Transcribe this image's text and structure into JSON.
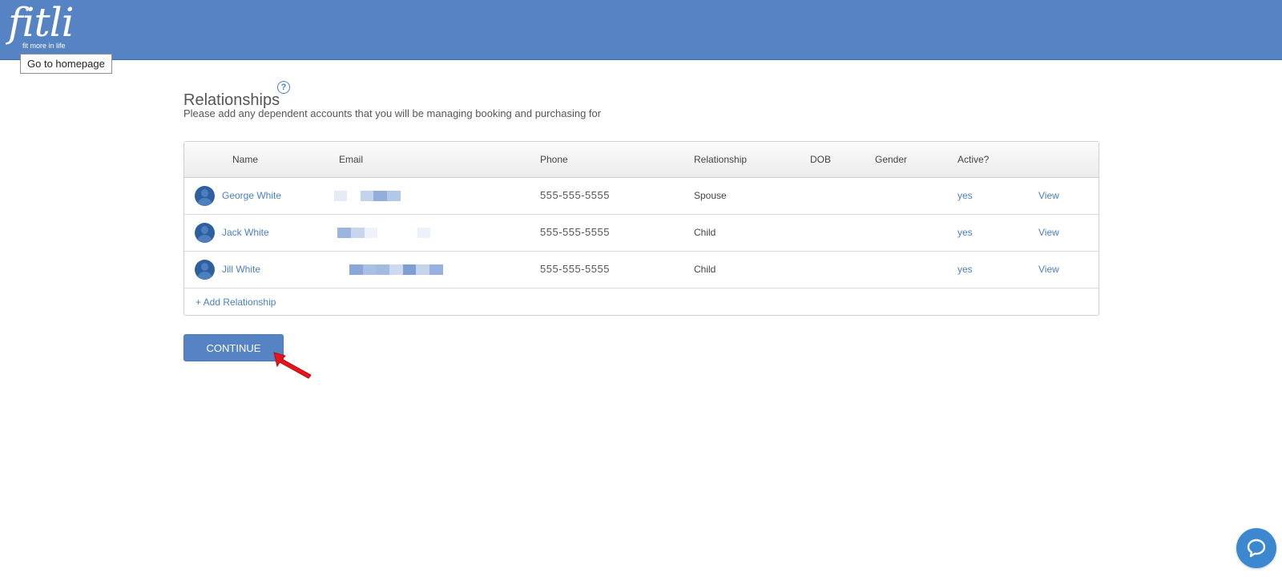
{
  "header": {
    "logo_text": "fitli",
    "logo_tagline": "fit more in life",
    "logo_tooltip": "Go to homepage"
  },
  "section": {
    "title": "Relationships",
    "help_icon": "question-circle-icon",
    "subtitle": "Please add any dependent accounts that you will be managing booking and purchasing for"
  },
  "table": {
    "columns": [
      "Name",
      "Email",
      "Phone",
      "Relationship",
      "DOB",
      "Gender",
      "Active?"
    ],
    "rows": [
      {
        "name": "George White",
        "email": "",
        "phone": "555-555-5555",
        "relationship": "Spouse",
        "dob": "",
        "gender": "",
        "active": "yes",
        "action": "View"
      },
      {
        "name": "Jack White",
        "email": "",
        "phone": "555-555-5555",
        "relationship": "Child",
        "dob": "",
        "gender": "",
        "active": "yes",
        "action": "View"
      },
      {
        "name": "Jill White",
        "email": "",
        "phone": "555-555-5555",
        "relationship": "Child",
        "dob": "",
        "gender": "",
        "active": "yes",
        "action": "View"
      }
    ],
    "add_label": "+ Add Relationship"
  },
  "continue_label": "CONTINUE",
  "chat_icon": "chat-bubble-icon",
  "colors": {
    "header_bg": "#5583c3",
    "link": "#4a7fc2",
    "button_bg": "#5583c3",
    "chat_bg": "#3b88d1",
    "arrow": "#e8141b"
  }
}
